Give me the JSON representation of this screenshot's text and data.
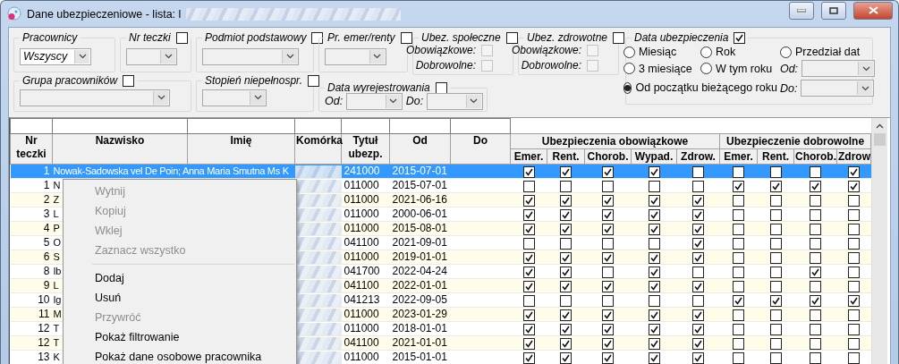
{
  "window": {
    "title": "Dane ubezpieczeniowe - lista: l"
  },
  "filters": [
    {
      "kind": "select",
      "legend": "Pracownicy",
      "value": "Wszyscy",
      "enabled": true
    },
    {
      "kind": "select",
      "legend": "Nr teczki",
      "checked": false,
      "enabled": false
    },
    {
      "kind": "select",
      "legend": "Podmiot podstawowy",
      "checked": false,
      "enabled": false
    },
    {
      "kind": "select",
      "legend": "Pr. emer/renty",
      "checked": false,
      "enabled": false
    },
    {
      "kind": "flags",
      "legend": "Ubez. społeczne",
      "checked": false,
      "flags": [
        {
          "label": "Obowiązkowe:",
          "checked": false,
          "disabled": true
        },
        {
          "label": "Dobrowolne:",
          "checked": false,
          "disabled": true
        }
      ]
    },
    {
      "kind": "flags",
      "legend": "Ubez. zdrowotne",
      "checked": false,
      "flags": [
        {
          "label": "Obowiązkowe:",
          "checked": false,
          "disabled": true
        },
        {
          "label": "Dobrowolne:",
          "checked": false,
          "disabled": true
        }
      ]
    },
    {
      "kind": "select",
      "legend": "Grupa pracowników",
      "checked": false,
      "enabled": false
    },
    {
      "kind": "select",
      "legend": "Stopień niepełnospr.",
      "checked": false,
      "enabled": false
    },
    {
      "kind": "range",
      "legend": "Data wyrejestrowania",
      "checked": false,
      "fields": [
        {
          "label": "Od:"
        },
        {
          "label": "Do:"
        }
      ]
    }
  ],
  "date_filter": {
    "legend": "Data ubezpieczenia",
    "checked": true,
    "options": [
      {
        "label": "Miesiąc",
        "selected": false
      },
      {
        "label": "Rok",
        "selected": false
      },
      {
        "label": "Przedział dat",
        "selected": false
      },
      {
        "label": "3 miesiące",
        "selected": false
      },
      {
        "label": "W tym roku",
        "selected": false
      },
      {
        "label": "Od początku bieżącego roku",
        "selected": true
      }
    ],
    "fields": [
      {
        "label": "Od:"
      },
      {
        "label": "Do:"
      }
    ]
  },
  "table": {
    "columns": [
      "Nr teczki",
      "Nazwisko",
      "Imię",
      "Komórka",
      "Tytuł ubezp.",
      "Od",
      "Do"
    ],
    "column_groups": [
      {
        "label": "Ubezpieczenia obowiązkowe",
        "columns": [
          "Emer.",
          "Rent.",
          "Chorob.",
          "Wypad.",
          "Zdrow."
        ]
      },
      {
        "label": "Ubezpieczenie dobrowolne",
        "columns": [
          "Emer.",
          "Rent.",
          "Chorob.",
          "Zdrow"
        ]
      }
    ],
    "rows": [
      {
        "nr": "1",
        "name": "Nowak-Sadowska vel De Poin; Anna Maria Smutna Ms K",
        "code": "241000",
        "from": "2015-07-01",
        "selected": true,
        "flags": [
          true,
          true,
          true,
          true,
          false,
          false,
          false,
          false,
          true
        ]
      },
      {
        "nr": "1",
        "name": "N",
        "code": "011000",
        "from": "2015-07-01",
        "selected": false,
        "flags": [
          false,
          false,
          false,
          false,
          false,
          true,
          true,
          true,
          true
        ]
      },
      {
        "nr": "2",
        "name": "Z",
        "code": "011000",
        "from": "2021-06-16",
        "selected": false,
        "flags": [
          true,
          true,
          true,
          true,
          true,
          false,
          false,
          false,
          false
        ]
      },
      {
        "nr": "3",
        "name": "L",
        "code": "011000",
        "from": "2000-06-01",
        "selected": false,
        "flags": [
          true,
          true,
          true,
          true,
          true,
          false,
          false,
          false,
          false
        ]
      },
      {
        "nr": "4",
        "name": "P",
        "code": "011000",
        "from": "2015-08-01",
        "selected": false,
        "flags": [
          true,
          true,
          true,
          true,
          true,
          false,
          false,
          false,
          false
        ]
      },
      {
        "nr": "5",
        "name": "O",
        "code": "041100",
        "from": "2021-09-01",
        "selected": false,
        "flags": [
          false,
          false,
          false,
          false,
          true,
          false,
          false,
          false,
          false
        ]
      },
      {
        "nr": "6",
        "name": "S",
        "code": "011000",
        "from": "2019-01-01",
        "selected": false,
        "flags": [
          true,
          true,
          true,
          true,
          true,
          false,
          false,
          false,
          false
        ]
      },
      {
        "nr": "8",
        "name": "Ib",
        "code": "041700",
        "from": "2022-04-24",
        "selected": false,
        "flags": [
          true,
          true,
          false,
          true,
          false,
          false,
          false,
          true,
          false
        ]
      },
      {
        "nr": "9",
        "name": "L",
        "code": "041100",
        "from": "2022-01-01",
        "selected": false,
        "flags": [
          true,
          true,
          true,
          true,
          true,
          false,
          false,
          false,
          false
        ]
      },
      {
        "nr": "10",
        "name": "Ig",
        "code": "041213",
        "from": "2022-09-05",
        "selected": false,
        "flags": [
          false,
          false,
          false,
          false,
          false,
          true,
          true,
          true,
          true
        ]
      },
      {
        "nr": "11",
        "name": "M",
        "code": "011000",
        "from": "2023-01-29",
        "selected": false,
        "flags": [
          true,
          true,
          true,
          true,
          true,
          false,
          false,
          false,
          false
        ]
      },
      {
        "nr": "12",
        "name": "T",
        "code": "011000",
        "from": "2018-01-01",
        "selected": false,
        "flags": [
          true,
          true,
          true,
          true,
          true,
          false,
          false,
          false,
          false
        ]
      },
      {
        "nr": "12",
        "name": "T",
        "code": "041100",
        "from": "2021-01-01",
        "selected": false,
        "flags": [
          true,
          true,
          true,
          true,
          true,
          false,
          false,
          false,
          false
        ]
      },
      {
        "nr": "13",
        "name": "K",
        "code": "011000",
        "from": "2015-01-01",
        "selected": false,
        "flags": [
          true,
          true,
          true,
          true,
          true,
          false,
          false,
          false,
          false
        ]
      }
    ]
  },
  "context_menu": {
    "items": [
      {
        "kind": "item",
        "label": "Wytnij",
        "disabled": true
      },
      {
        "kind": "item",
        "label": "Kopiuj",
        "disabled": true
      },
      {
        "kind": "item",
        "label": "Wklej",
        "disabled": true
      },
      {
        "kind": "item",
        "label": "Zaznacz wszystko",
        "disabled": true
      },
      {
        "kind": "separator"
      },
      {
        "kind": "item",
        "label": "Dodaj",
        "disabled": false
      },
      {
        "kind": "item",
        "label": "Usuń",
        "disabled": false
      },
      {
        "kind": "item",
        "label": "Przywróć",
        "disabled": true
      },
      {
        "kind": "item",
        "label": "Pokaż filtrowanie",
        "disabled": false
      },
      {
        "kind": "item",
        "label": "Pokaż dane osobowe pracownika",
        "disabled": false
      }
    ]
  }
}
